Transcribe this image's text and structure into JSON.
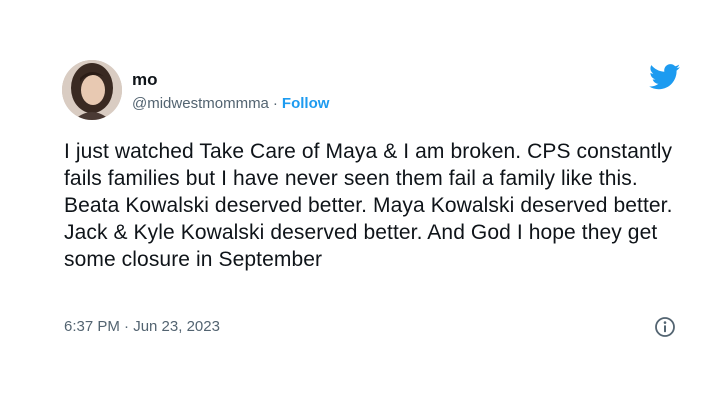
{
  "tweet": {
    "author": {
      "display_name": "mo",
      "handle": "@midwestmommma",
      "avatar_icon": "profile-photo"
    },
    "separator": "·",
    "follow_label": "Follow",
    "text": "I just watched Take Care of Maya & I am broken. CPS constantly fails families but I have never seen them fail a family like this. Beata Kowalski deserved better. Maya Kowalski deserved better. Jack & Kyle Kowalski deserved better. And God I hope they get some closure in September",
    "timestamp": "6:37 PM · Jun 23, 2023",
    "platform_icon": "twitter-bird-icon",
    "info_icon": "info-icon"
  },
  "colors": {
    "accent": "#1d9bf0",
    "text_primary": "#0f1419",
    "text_secondary": "#536471",
    "background": "#ffffff"
  }
}
